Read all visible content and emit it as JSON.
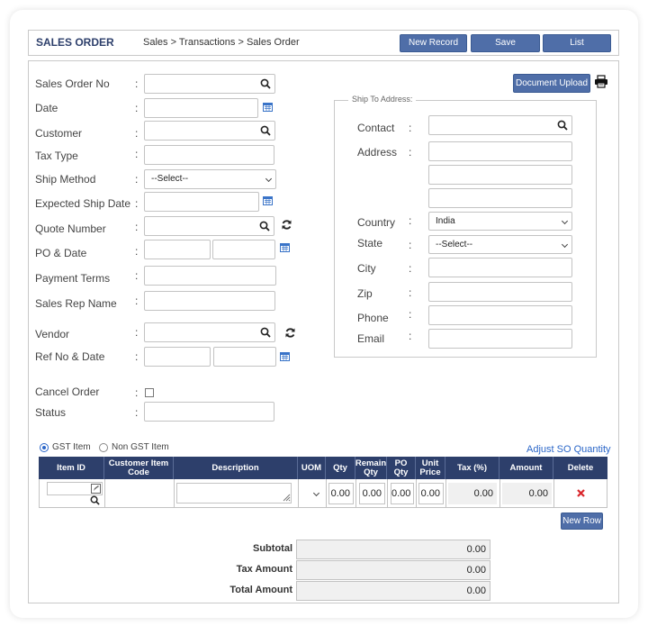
{
  "header": {
    "title": "SALES ORDER",
    "breadcrumb": "Sales > Transactions > Sales Order",
    "buttons": {
      "new_record": "New Record",
      "save": "Save",
      "list": "List"
    }
  },
  "form": {
    "sales_order_no": {
      "label": "Sales Order No",
      "value": ""
    },
    "date": {
      "label": "Date",
      "value": ""
    },
    "customer": {
      "label": "Customer",
      "value": ""
    },
    "tax_type": {
      "label": "Tax Type",
      "value": ""
    },
    "ship_method": {
      "label": "Ship Method",
      "value": "--Select--"
    },
    "expected_ship_date": {
      "label": "Expected Ship Date",
      "value": ""
    },
    "quote_number": {
      "label": "Quote Number",
      "value": ""
    },
    "po_date": {
      "label": "PO & Date",
      "value": ""
    },
    "payment_terms": {
      "label": "Payment Terms",
      "value": ""
    },
    "sales_rep_name": {
      "label": "Sales Rep Name",
      "value": ""
    },
    "vendor": {
      "label": "Vendor",
      "value": ""
    },
    "ref_no_date": {
      "label": "Ref No & Date",
      "value": ""
    },
    "cancel_order": {
      "label": "Cancel Order",
      "checked": false
    },
    "status": {
      "label": "Status",
      "value": ""
    },
    "colon": ":"
  },
  "document_upload": "Document Upload",
  "ship_to": {
    "legend": "Ship To Address:",
    "contact": "Contact",
    "address": "Address",
    "country": {
      "label": "Country",
      "value": "India"
    },
    "state": {
      "label": "State",
      "value": "--Select--"
    },
    "city": "City",
    "zip": "Zip",
    "phone": "Phone",
    "email": "Email"
  },
  "item_type": {
    "gst": "GST Item",
    "non_gst": "Non GST Item",
    "selected": "gst"
  },
  "adjust_link": "Adjust SO Quantity",
  "table": {
    "columns": [
      "Item ID",
      "Customer Item Code",
      "Description",
      "UOM",
      "Qty",
      "Remain Qty",
      "PO Qty",
      "Unit Price",
      "Tax (%)",
      "Amount",
      "Delete"
    ],
    "row": {
      "qty": "0.00",
      "remain_qty": "0.00",
      "po_qty": "0.00",
      "unit_price": "0.00",
      "tax": "0.00",
      "amount": "0.00"
    }
  },
  "new_row": "New Row",
  "totals": {
    "subtotal": {
      "label": "Subtotal",
      "value": "0.00"
    },
    "tax_amount": {
      "label": "Tax Amount",
      "value": "0.00"
    },
    "total_amount": {
      "label": "Total Amount",
      "value": "0.00"
    }
  },
  "colors": {
    "accent": "#4f6ea8",
    "header_dark": "#2d3f6b",
    "link": "#2a66c8",
    "delete": "#d9262b"
  }
}
